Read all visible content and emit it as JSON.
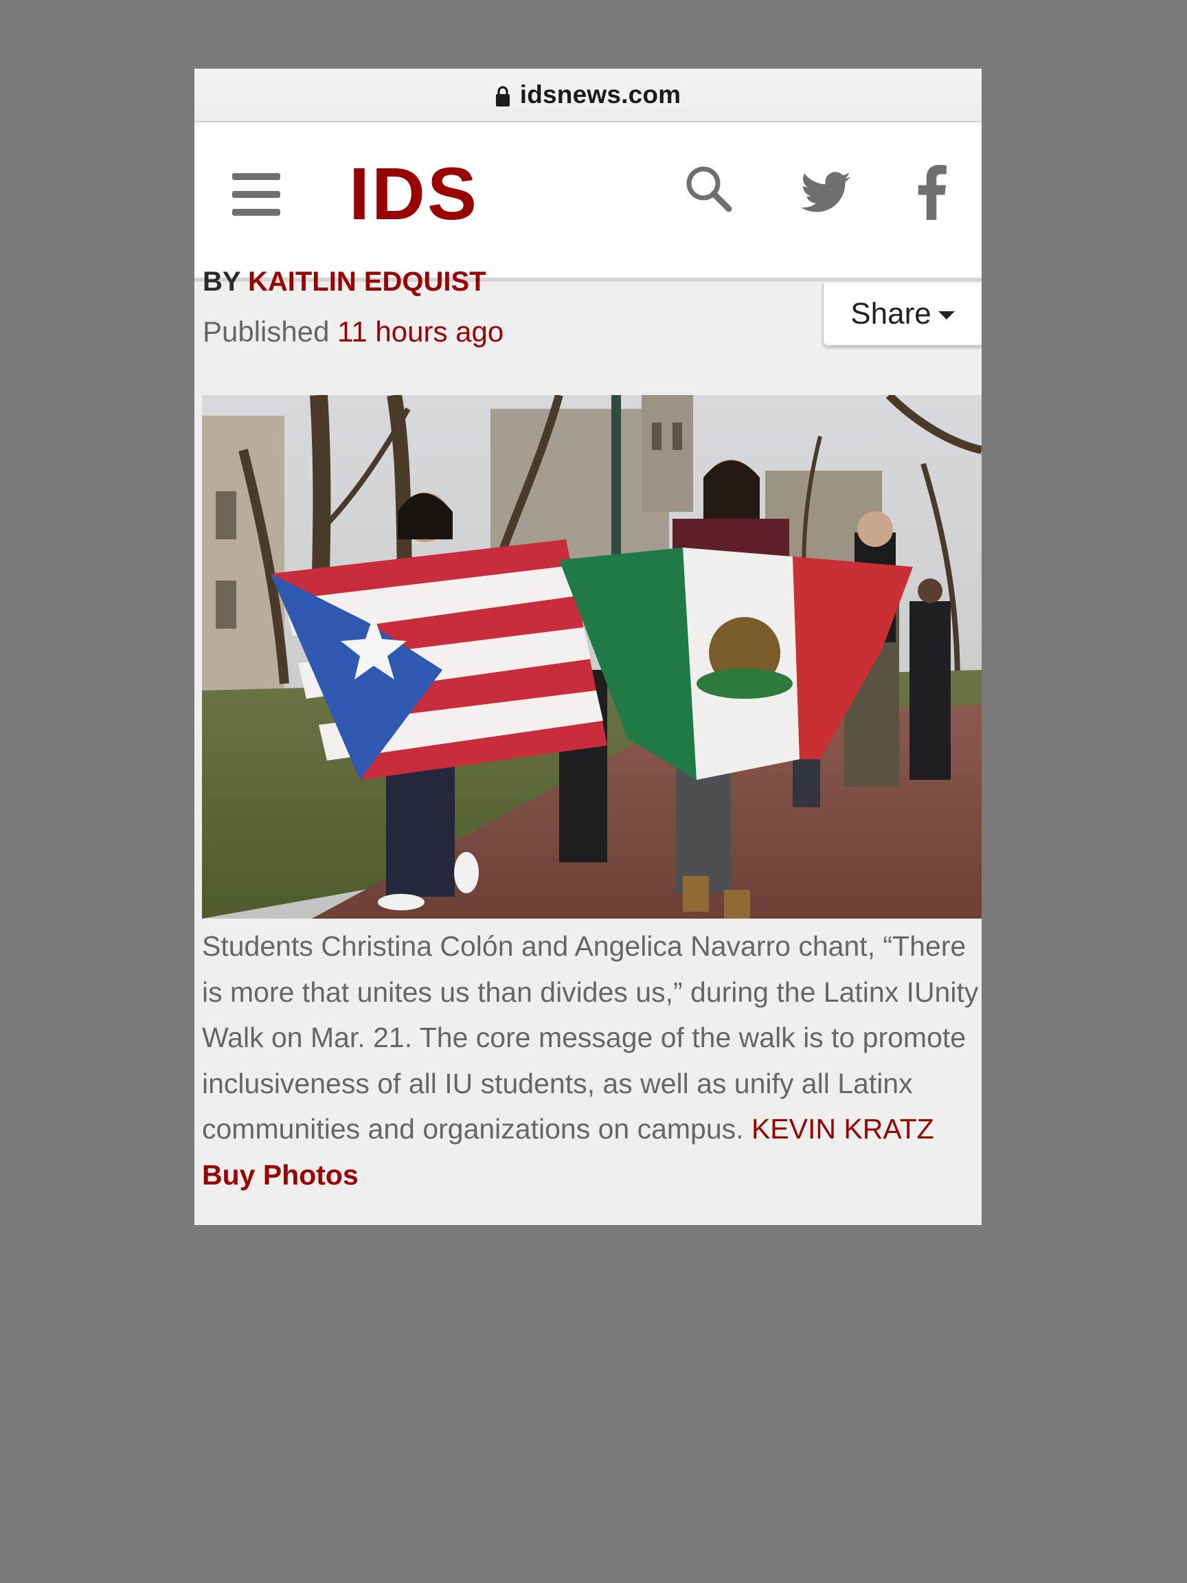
{
  "browser": {
    "domain": "idsnews.com",
    "lock_icon": "lock-icon"
  },
  "header": {
    "logo_text": "IDS",
    "logo_color": "#990000",
    "icons": [
      "menu-icon",
      "search-icon",
      "twitter-icon",
      "facebook-icon"
    ]
  },
  "article": {
    "byline_prefix": "BY",
    "author": "KAITLIN EDQUIST",
    "published_label": "Published",
    "published_time": "11 hours ago",
    "share_label": "Share"
  },
  "photo": {
    "description_icon": "photo-image"
  },
  "caption": {
    "text": "Students Christina Colón and Angelica Navarro chant, “There is more that unites us than divides us,” during the Latinx IUnity Walk on Mar. 21. The core message of the walk is to promote inclusiveness of all IU students, as well as unify all Latinx communities and organizations on campus.",
    "credit": "KEVIN KRATZ",
    "buy_link": "Buy Photos"
  },
  "colors": {
    "accent": "#990000",
    "page_background": "#7a7a7a",
    "content_background": "#f0efef"
  }
}
